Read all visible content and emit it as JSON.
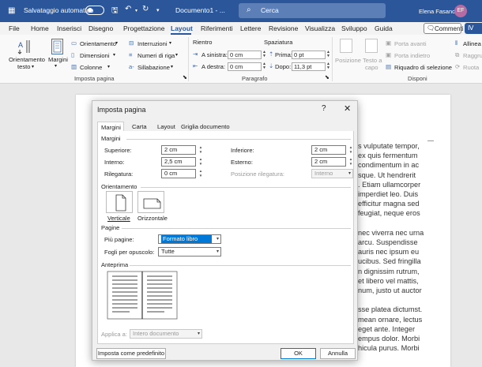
{
  "titlebar": {
    "autosave_label": "Salvataggio automatico",
    "doc_title": "Documento1 - ...",
    "search_placeholder": "Cerca",
    "user_name": "Elena Fasano",
    "user_initials": "EF"
  },
  "menu": {
    "tabs": [
      "File",
      "Home",
      "Inserisci",
      "Disegno",
      "Progettazione",
      "Layout",
      "Riferimenti",
      "Lettere",
      "Revisione",
      "Visualizza",
      "Sviluppo",
      "Guida"
    ],
    "active_tab": "Layout",
    "comments_label": "Commenti",
    "share_label": "Ⅳ"
  },
  "ribbon": {
    "orientamento_testo": [
      "Orientamento",
      "testo"
    ],
    "margini": "Margini",
    "orientamento": "Orientamento",
    "dimensioni": "Dimensioni",
    "colonne": "Colonne",
    "interruzioni": "Interruzioni",
    "numeri_riga": "Numeri di riga",
    "sillabazione": "Sillabazione",
    "group_imposta_pagina": "Imposta pagina",
    "rientro": "Rientro",
    "a_sinistra": "A sinistra:",
    "a_destra": "A destra:",
    "rientro_sx": "0 cm",
    "rientro_dx": "0 cm",
    "spaziatura": "Spaziatura",
    "prima": "Prima:",
    "dopo": "Dopo:",
    "prima_val": "0 pt",
    "dopo_val": "11,3 pt",
    "group_paragrafo": "Paragrafo",
    "posizione": "Posizione",
    "testo_a_capo": [
      "Testo a",
      "capo"
    ],
    "porta_avanti": "Porta avanti",
    "porta_indietro": "Porta indietro",
    "riquadro_selezione": "Riquadro di selezione",
    "allinea": "Allinea",
    "raggruppa": "Raggru",
    "ruota": "Ruota",
    "group_disponi": "Disponi"
  },
  "document": {
    "lines": [
      "s vulputate tempor,",
      "ex quis fermentum",
      "condimentum in ac",
      "sque. Ut hendrerit",
      ". Etiam ullamcorper",
      "imperdiet leo. Duis",
      "efficitur magna sed",
      "feugiat, neque eros",
      "",
      "nec viverra nec urna",
      "arcu. Suspendisse",
      "auris nec ipsum eu",
      "ucibus. Sed fringilla",
      "n dignissim rutrum,",
      "et libero vel mattis,",
      "num, justo ut auctor",
      "",
      "sse platea dictumst.",
      "mean ornare, lectus",
      "eget ante. Integer",
      "empus dolor. Morbi",
      "hicula purus. Morbi"
    ]
  },
  "dialog": {
    "title": "Imposta pagina",
    "help": "?",
    "close": "✕",
    "tabs": [
      "Margini",
      "Carta",
      "Layout",
      "Griglia documento"
    ],
    "active_tab": "Margini",
    "margini_title": "Margini",
    "superiore_label": "Superiore:",
    "superiore": "2 cm",
    "inferiore_label": "Inferiore:",
    "inferiore": "2 cm",
    "interno_label": "Interno:",
    "interno": "2,5 cm",
    "esterno_label": "Esterno:",
    "esterno": "2 cm",
    "rilegatura_label": "Rilegatura:",
    "rilegatura": "0 cm",
    "pos_rilegatura_label": "Posizione rilegatura:",
    "pos_rilegatura": "Interno",
    "orientamento_title": "Orientamento",
    "verticale": "Verticale",
    "orizzontale": "Orizzontale",
    "pagine_title": "Pagine",
    "piu_pagine_label": "Più pagine:",
    "piu_pagine": "Formato libro",
    "fogli_label": "Fogli per opuscolo:",
    "fogli": "Tutte",
    "anteprima_title": "Anteprima",
    "applica_label": "Applica a:",
    "applica": "Intero documento",
    "default_btn": "Imposta come predefinito",
    "ok_btn": "OK",
    "cancel_btn": "Annulla"
  }
}
